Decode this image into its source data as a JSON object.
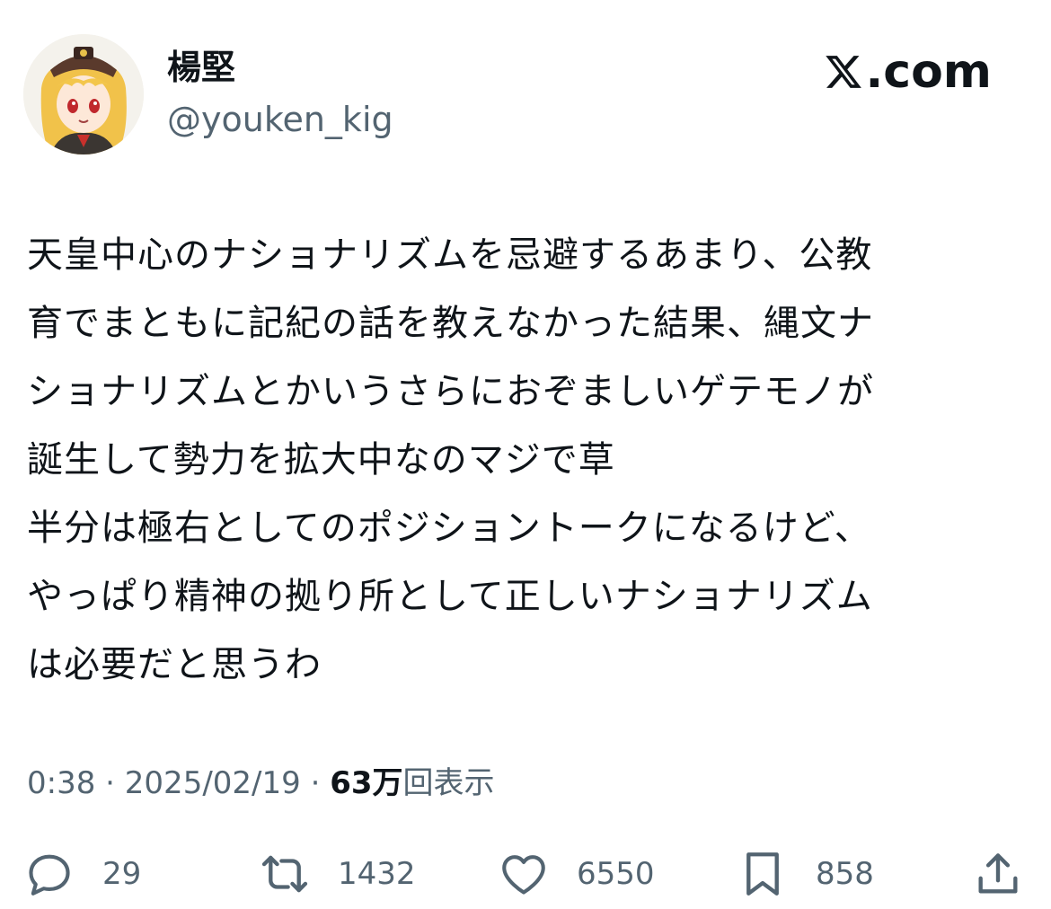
{
  "brand": {
    "text": ".com"
  },
  "author": {
    "display_name": "楊堅",
    "handle": "@youken_kig"
  },
  "tweet": {
    "lines": [
      "天皇中心のナショナリズムを忌避するあまり、公教",
      "育でまともに記紀の話を教えなかった結果、縄文ナ",
      "ショナリズムとかいうさらにおぞましいゲテモノが",
      "誕生して勢力を拡大中なのマジで草",
      "半分は極右としてのポジショントークになるけど、",
      "やっぱり精神の拠り所として正しいナショナリズム",
      "は必要だと思うわ"
    ]
  },
  "meta": {
    "time": "0:38",
    "sep1": " · ",
    "date": "2025/02/19",
    "sep2": " · ",
    "views_count": "63万",
    "views_label": "回表示"
  },
  "actions": {
    "replies": "29",
    "reposts": "1432",
    "likes": "6550",
    "bookmarks": "858"
  },
  "icons": {
    "brand_logo": "x-logo-icon",
    "reply": "reply-icon",
    "repost": "repost-icon",
    "like": "heart-icon",
    "bookmark": "bookmark-icon",
    "share": "share-icon"
  },
  "colors": {
    "text": "#0f1419",
    "secondary": "#536471"
  }
}
